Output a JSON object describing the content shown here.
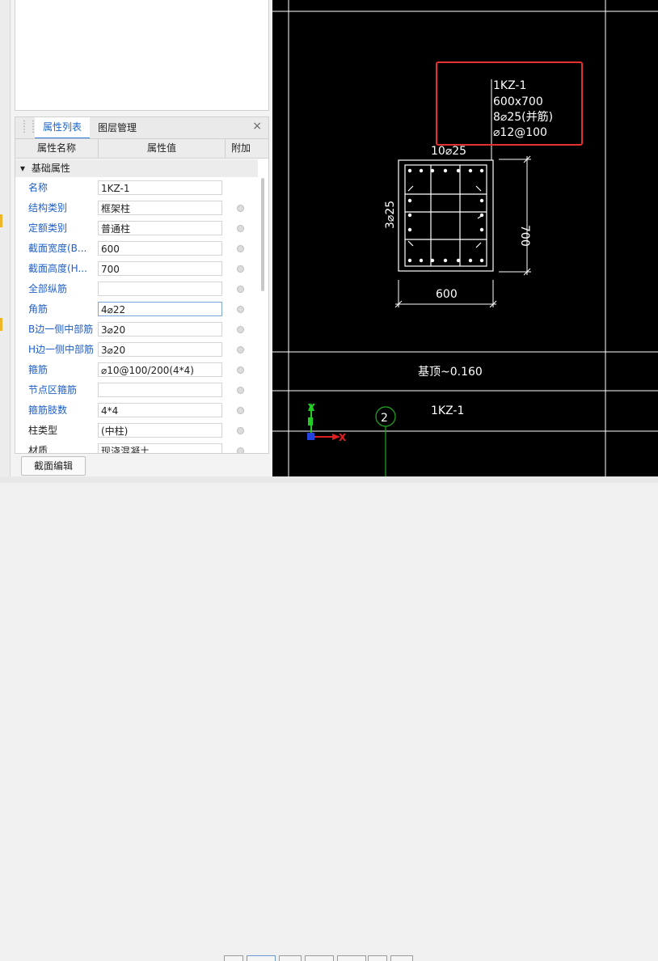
{
  "panel": {
    "tabs": [
      {
        "label": "属性列表",
        "active": true
      },
      {
        "label": "图层管理",
        "active": false
      }
    ],
    "close_glyph": "×",
    "columns": [
      "属性名称",
      "属性值",
      "附加"
    ],
    "section": "基础属性",
    "section_toggle": "▾",
    "properties": [
      {
        "name": "名称",
        "value": "1KZ-1",
        "addon": false,
        "dark": false
      },
      {
        "name": "结构类别",
        "value": "框架柱",
        "addon": true,
        "dark": false
      },
      {
        "name": "定额类别",
        "value": "普通柱",
        "addon": true,
        "dark": false
      },
      {
        "name": "截面宽度(B...",
        "value": "600",
        "addon": true,
        "dark": false
      },
      {
        "name": "截面高度(H...",
        "value": "700",
        "addon": true,
        "dark": false
      },
      {
        "name": "全部纵筋",
        "value": "",
        "addon": true,
        "dark": false
      },
      {
        "name": "角筋",
        "value": "4⌀22",
        "addon": true,
        "dark": false,
        "focus": true
      },
      {
        "name": "B边一侧中部筋",
        "value": "3⌀20",
        "addon": true,
        "dark": false
      },
      {
        "name": "H边一侧中部筋",
        "value": "3⌀20",
        "addon": true,
        "dark": false
      },
      {
        "name": "箍筋",
        "value": "⌀10@100/200(4*4)",
        "addon": true,
        "dark": false
      },
      {
        "name": "节点区箍筋",
        "value": "",
        "addon": true,
        "dark": false
      },
      {
        "name": "箍筋肢数",
        "value": "4*4",
        "addon": true,
        "dark": false
      },
      {
        "name": "柱类型",
        "value": "(中柱)",
        "addon": true,
        "dark": true
      },
      {
        "name": "材质",
        "value": "现浇混凝土",
        "addon": true,
        "dark": true
      }
    ],
    "button": "截面编辑",
    "collapse_glyph": "‹"
  },
  "drawing": {
    "label": [
      "1KZ-1",
      "600x700",
      "8⌀25(并筋)",
      "⌀12@100"
    ],
    "top_bars": "10⌀25",
    "side_bars": "3⌀25",
    "dim_height": "700",
    "dim_width": "600",
    "elevation": "基顶~0.160",
    "column_name": "1KZ-1",
    "axis_number": "2",
    "ucs_y": "Y",
    "ucs_x": "X",
    "colors": {
      "background": "#000000",
      "lines": "#ffffff",
      "highlight": "#e53030",
      "axis": "#22aa22",
      "ucs_y": "#22cc22",
      "ucs_x": "#e02020"
    }
  }
}
